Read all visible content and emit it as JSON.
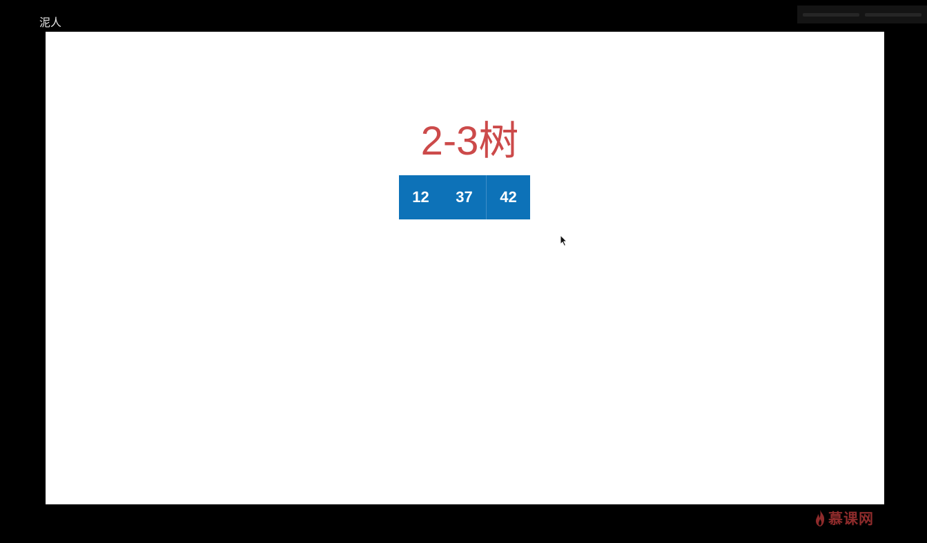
{
  "overlay": {
    "top_left_text": "泥人",
    "brand_text": "慕课网",
    "brand_icon": "flame-icon"
  },
  "slide": {
    "title": "2-3树",
    "title_color": "#cc4a4a",
    "node_color": "#0d72b8",
    "node": {
      "left_keys": [
        "12",
        "37"
      ],
      "right_keys": [
        "42"
      ]
    }
  },
  "colors": {
    "background": "#000000",
    "slide_background": "#ffffff",
    "brand": "#8e2b2b"
  }
}
